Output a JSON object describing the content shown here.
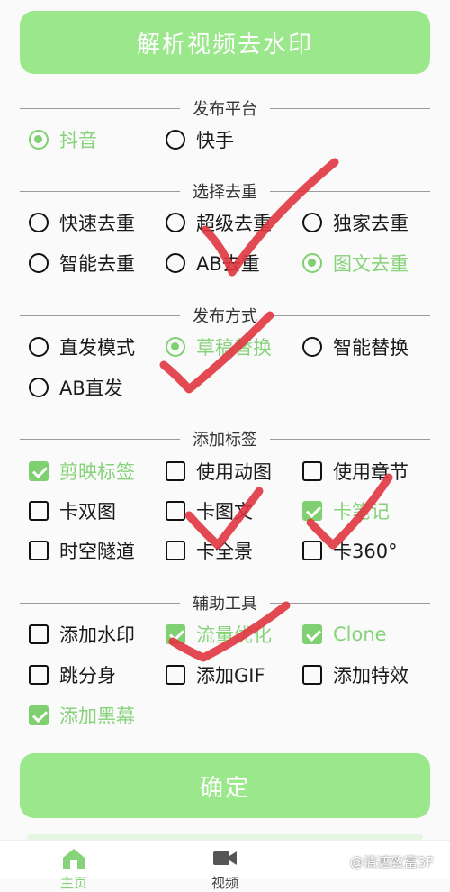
{
  "top_button": "解析视频去水印",
  "sections": {
    "platform": {
      "title": "发布平台",
      "options": [
        {
          "label": "抖音",
          "checked": true
        },
        {
          "label": "快手",
          "checked": false
        }
      ]
    },
    "dedup": {
      "title": "选择去重",
      "options": [
        {
          "label": "快速去重",
          "checked": false
        },
        {
          "label": "超级去重",
          "checked": false
        },
        {
          "label": "独家去重",
          "checked": false
        },
        {
          "label": "智能去重",
          "checked": false
        },
        {
          "label": "AB去重",
          "checked": false
        },
        {
          "label": "图文去重",
          "checked": true
        }
      ]
    },
    "method": {
      "title": "发布方式",
      "options": [
        {
          "label": "直发模式",
          "checked": false
        },
        {
          "label": "草稿替换",
          "checked": true
        },
        {
          "label": "智能替换",
          "checked": false
        },
        {
          "label": "AB直发",
          "checked": false
        }
      ]
    },
    "tags": {
      "title": "添加标签",
      "options": [
        {
          "label": "剪映标签",
          "checked": true
        },
        {
          "label": "使用动图",
          "checked": false
        },
        {
          "label": "使用章节",
          "checked": false
        },
        {
          "label": "卡双图",
          "checked": false
        },
        {
          "label": "卡图文",
          "checked": false
        },
        {
          "label": "卡笔记",
          "checked": true
        },
        {
          "label": "时空隧道",
          "checked": false
        },
        {
          "label": "卡全景",
          "checked": false
        },
        {
          "label": "卡360°",
          "checked": false
        }
      ]
    },
    "tools": {
      "title": "辅助工具",
      "options": [
        {
          "label": "添加水印",
          "checked": false
        },
        {
          "label": "流量优化",
          "checked": true
        },
        {
          "label": "Clone",
          "checked": true
        },
        {
          "label": "跳分身",
          "checked": false
        },
        {
          "label": "添加GIF",
          "checked": false
        },
        {
          "label": "添加特效",
          "checked": false
        },
        {
          "label": "添加黑幕",
          "checked": true
        }
      ]
    }
  },
  "confirm_button": "确定",
  "nav": [
    {
      "label": "主页",
      "icon": "home-icon"
    },
    {
      "label": "视频",
      "icon": "video-camera-icon"
    }
  ],
  "watermark": "@清遮致富3F",
  "colors": {
    "accent": "#9be88c",
    "selected_text": "#86d37a",
    "annotation": "#e0353f"
  }
}
